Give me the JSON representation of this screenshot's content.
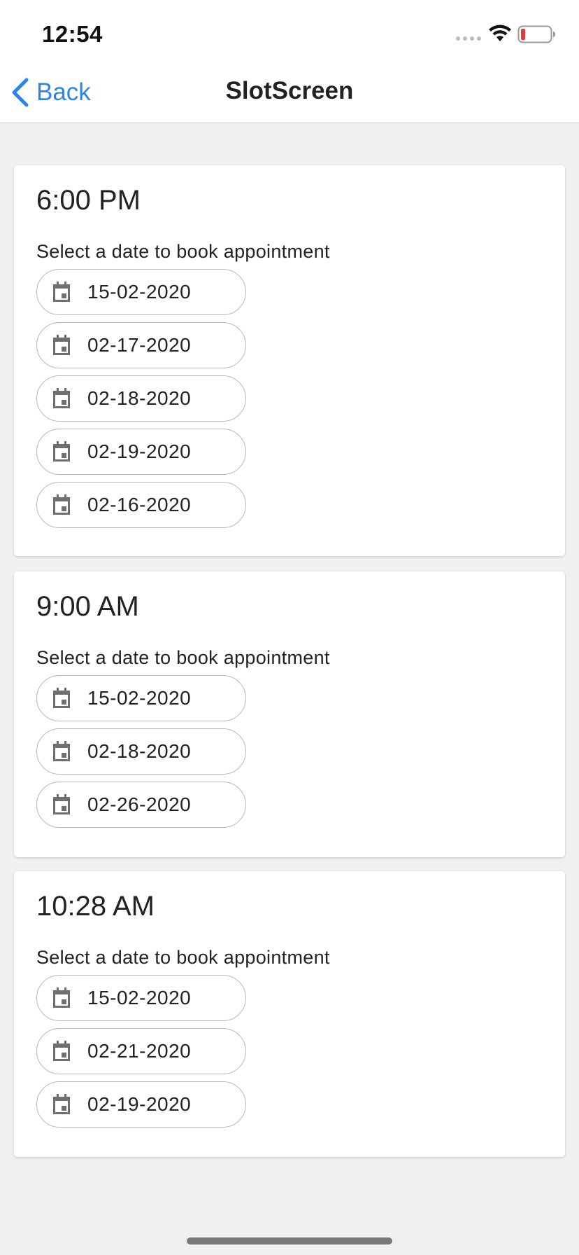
{
  "status_bar": {
    "time": "12:54"
  },
  "nav": {
    "back_label": "Back",
    "title": "SlotScreen"
  },
  "slots": [
    {
      "time": "6:00 PM",
      "instruction": "Select a date to book appointment",
      "dates": [
        "15-02-2020",
        "02-17-2020",
        "02-18-2020",
        "02-19-2020",
        "02-16-2020"
      ]
    },
    {
      "time": "9:00 AM",
      "instruction": "Select a date to book appointment",
      "dates": [
        "15-02-2020",
        "02-18-2020",
        "02-26-2020"
      ]
    },
    {
      "time": "10:28 AM",
      "instruction": "Select a date to book appointment",
      "dates": [
        "15-02-2020",
        "02-21-2020",
        "02-19-2020"
      ]
    }
  ],
  "colors": {
    "accent": "#2b84ea",
    "background": "#f0f0f0",
    "card": "#ffffff",
    "battery_low": "#e53935"
  },
  "icons": {
    "back": "chevron-left-icon",
    "date": "calendar-icon",
    "wifi": "wifi-icon",
    "battery": "battery-icon",
    "signal": "cellular-signal-icon"
  }
}
